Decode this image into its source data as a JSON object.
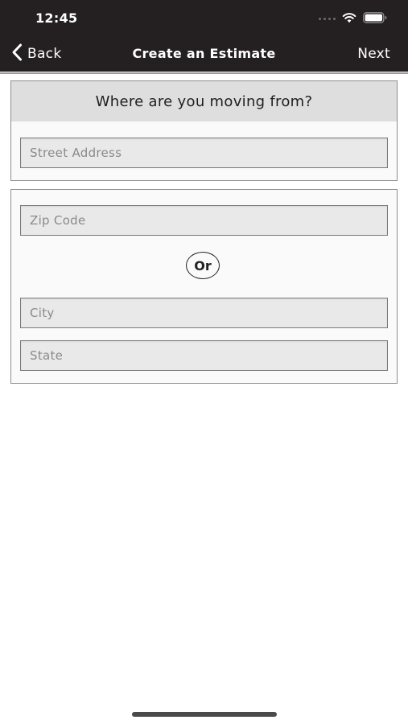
{
  "status_bar": {
    "time": "12:45",
    "icons": [
      "cellular-dots-icon",
      "wifi-icon",
      "battery-icon"
    ]
  },
  "nav": {
    "back_label": "Back",
    "title": "Create an Estimate",
    "next_label": "Next"
  },
  "moving_from": {
    "heading": "Where are you moving from?",
    "street_placeholder": "Street Address",
    "street_value": ""
  },
  "location": {
    "zip_placeholder": "Zip Code",
    "zip_value": "",
    "or_label": "Or",
    "city_placeholder": "City",
    "city_value": "",
    "state_placeholder": "State",
    "state_value": ""
  },
  "colors": {
    "bar_background": "#242021",
    "card_header": "#dedede",
    "field_background": "#e9e9e9"
  }
}
